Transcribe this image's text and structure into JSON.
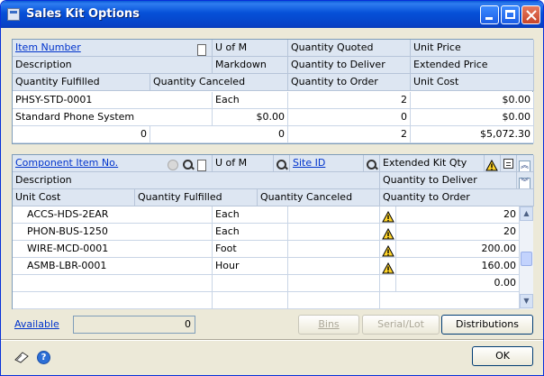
{
  "window": {
    "title": "Sales Kit Options"
  },
  "top_grid": {
    "headers": {
      "item_number": "Item Number",
      "u_of_m": "U of M",
      "quantity_quoted": "Quantity Quoted",
      "unit_price": "Unit Price",
      "description": "Description",
      "markdown": "Markdown",
      "quantity_to_deliver": "Quantity to Deliver",
      "extended_price": "Extended Price",
      "quantity_fulfilled": "Quantity Fulfilled",
      "quantity_canceled": "Quantity Canceled",
      "quantity_to_order": "Quantity to Order",
      "unit_cost": "Unit Cost"
    },
    "row": {
      "item_number": "PHSY-STD-0001",
      "u_of_m": "Each",
      "quantity_quoted": "2",
      "unit_price": "$0.00",
      "description": "Standard Phone System",
      "markdown": "$0.00",
      "quantity_to_deliver": "0",
      "extended_price": "$0.00",
      "quantity_fulfilled": "0",
      "quantity_canceled": "0",
      "quantity_to_order": "2",
      "unit_cost": "$5,072.30"
    }
  },
  "component_grid": {
    "headers": {
      "component_item": "Component Item No.",
      "u_of_m": "U of M",
      "site_id": "Site ID",
      "extended_kit_qty": "Extended Kit Qty",
      "description": "Description",
      "quantity_to_deliver": "Quantity to Deliver",
      "unit_cost": "Unit Cost",
      "quantity_fulfilled": "Quantity Fulfilled",
      "quantity_canceled": "Quantity Canceled",
      "quantity_to_order": "Quantity to Order"
    },
    "rows": [
      {
        "item": "ACCS-HDS-2EAR",
        "uom": "Each",
        "qty": "20"
      },
      {
        "item": "PHON-BUS-1250",
        "uom": "Each",
        "qty": "20"
      },
      {
        "item": "WIRE-MCD-0001",
        "uom": "Foot",
        "qty": "200.00"
      },
      {
        "item": "ASMB-LBR-0001",
        "uom": "Hour",
        "qty": "160.00"
      },
      {
        "item": "",
        "uom": "",
        "qty": "0.00"
      }
    ]
  },
  "footer": {
    "available_label": "Available",
    "available_value": "0",
    "bins": "Bins",
    "serial_lot": "Serial/Lot",
    "distributions": "Distributions",
    "ok": "OK"
  }
}
